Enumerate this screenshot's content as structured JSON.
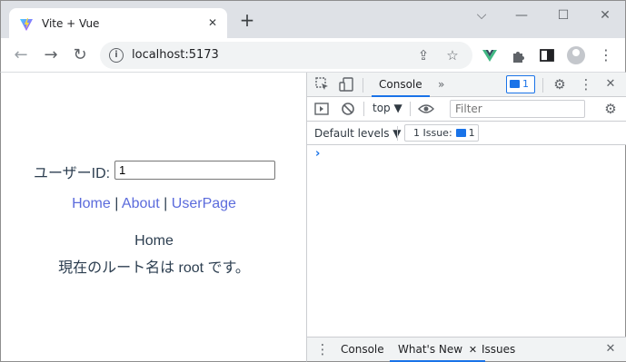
{
  "browser": {
    "tab_title": "Vite + Vue",
    "tab_close": "✕",
    "new_tab": "+",
    "url": "localhost:5173",
    "window_controls": {
      "dropdown": "⌵",
      "minimize": "—",
      "maximize": "☐",
      "close": "✕"
    },
    "nav": {
      "back": "←",
      "forward": "→",
      "reload": "↻"
    },
    "omnibox_icons": {
      "info": "i",
      "share": "⇪",
      "bookmark": "☆"
    },
    "toolbar_icons": {
      "vue_devtools": "vue-icon",
      "extensions": "puzzle-icon",
      "side_panel": "side-panel-icon",
      "profile": "avatar",
      "menu": "⋮"
    }
  },
  "page": {
    "userid_label": "ユーザーID:",
    "userid_value": "1",
    "nav_links": {
      "home": "Home",
      "sep1": " | ",
      "about": "About",
      "sep2": " | ",
      "userpage": "UserPage"
    },
    "view_title": "Home",
    "route_message": "現在のルート名は root です。",
    "link_color": "#5b6bdc",
    "text_color": "#2c3e50"
  },
  "devtools": {
    "tabs": {
      "console": "Console",
      "more": "»"
    },
    "message_count": "1",
    "toolbar_icons": {
      "settings": "⚙",
      "menu": "⋮",
      "close": "✕"
    },
    "filterbar": {
      "context": "top ▼",
      "filter_placeholder": "Filter"
    },
    "levels": "Default levels ▼",
    "issues": {
      "label": "1 Issue:",
      "count": "1"
    },
    "prompt": "›",
    "drawer": {
      "menu": "⋮",
      "console": "Console",
      "whats_new": "What's New",
      "whats_new_close": "✕",
      "issues": "Issues",
      "close": "✕"
    },
    "accent": "#1a73e8"
  }
}
